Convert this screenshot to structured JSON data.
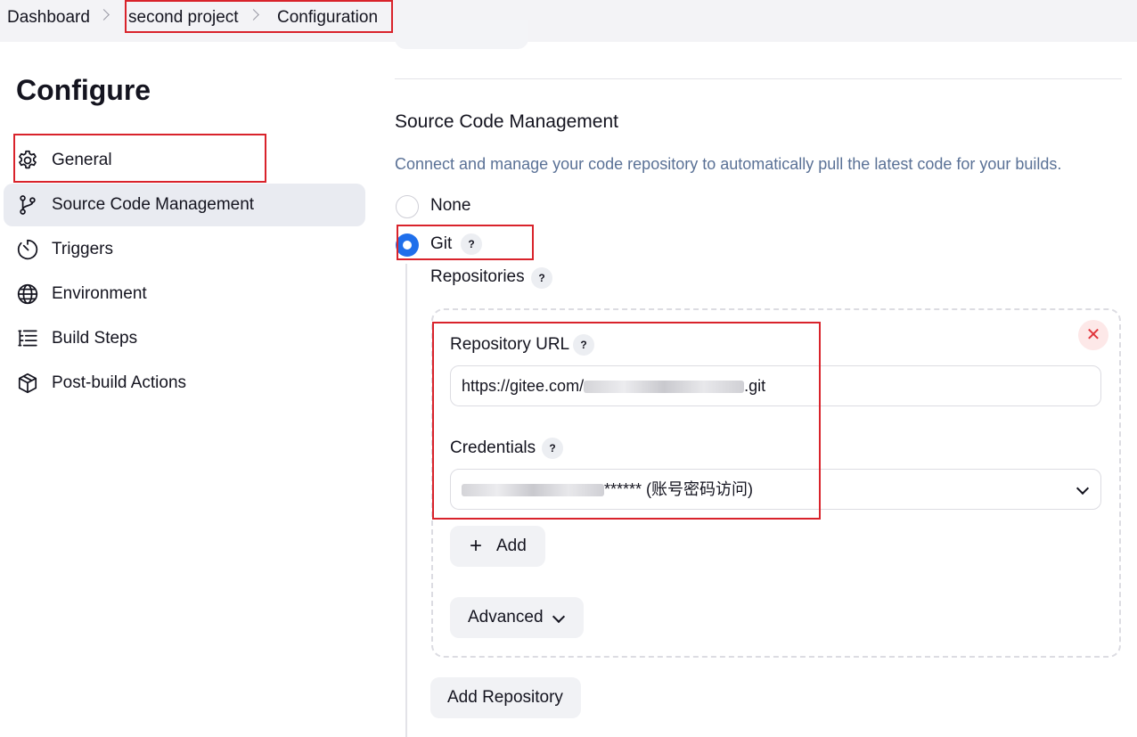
{
  "breadcrumb": {
    "items": [
      "Dashboard",
      "second project",
      "Configuration"
    ]
  },
  "sidebar": {
    "title": "Configure",
    "items": [
      {
        "label": "General",
        "icon": "gear-icon"
      },
      {
        "label": "Source Code Management",
        "icon": "branch-icon"
      },
      {
        "label": "Triggers",
        "icon": "timer-icon"
      },
      {
        "label": "Environment",
        "icon": "globe-icon"
      },
      {
        "label": "Build Steps",
        "icon": "list-icon"
      },
      {
        "label": "Post-build Actions",
        "icon": "package-icon"
      }
    ],
    "active_item": "Source Code Management"
  },
  "scm": {
    "title": "Source Code Management",
    "description": "Connect and manage your code repository to automatically pull the latest code for your builds.",
    "options": [
      {
        "label": "None",
        "selected": false
      },
      {
        "label": "Git",
        "selected": true
      }
    ],
    "help_mark": "?",
    "repositories_label": "Repositories",
    "repository": {
      "url_label": "Repository URL",
      "url_value_prefix": "https://gitee.com/",
      "url_value_suffix": ".git",
      "credentials_label": "Credentials",
      "credentials_value": "****** (账号密码访问)",
      "remove_glyph": "✕",
      "add_label": "Add",
      "add_glyph": "+",
      "advanced_label": "Advanced"
    },
    "add_repository_label": "Add Repository"
  },
  "colors": {
    "accent": "#1f6feb",
    "highlight_box": "#d9232b",
    "description_text": "#5a7196",
    "danger": "#e0353c"
  }
}
